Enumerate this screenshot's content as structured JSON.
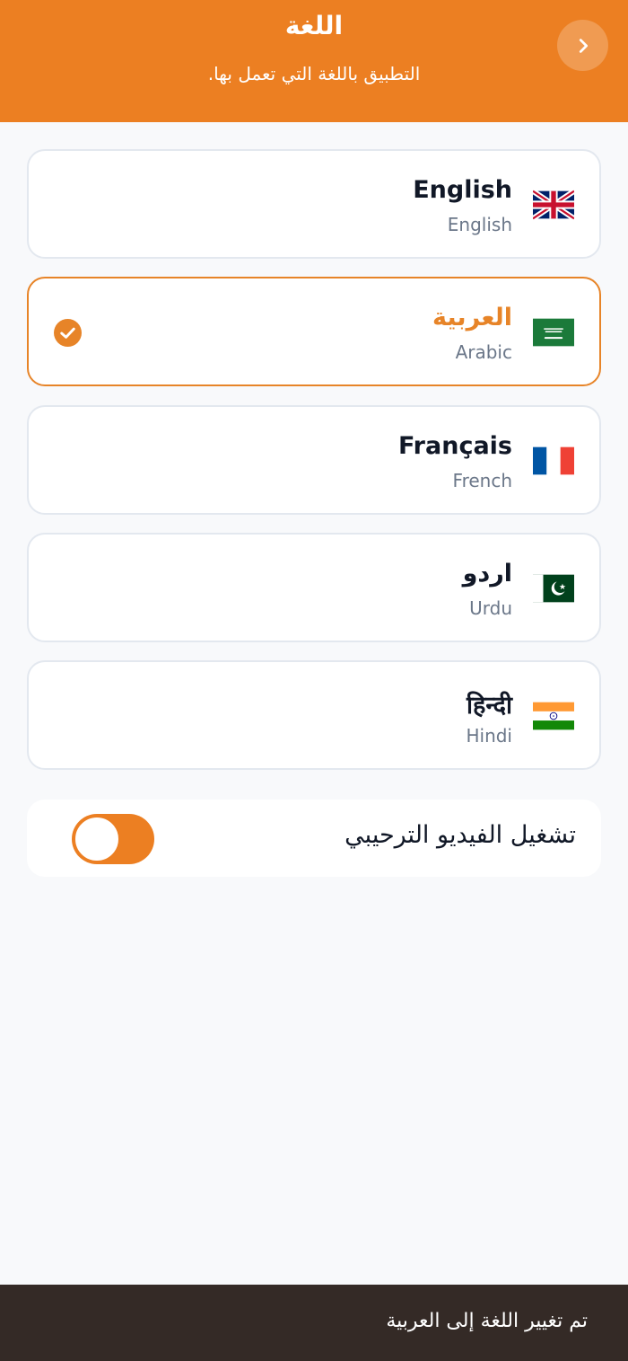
{
  "header": {
    "title": "اللغة",
    "subtitle": "التطبيق باللغة التي تعمل بها.",
    "back_icon": "chevron-right-icon"
  },
  "languages": [
    {
      "name": "English",
      "sub": "English",
      "flag": "uk-flag-icon",
      "selected": false
    },
    {
      "name": "العربية",
      "sub": "Arabic",
      "flag": "saudi-flag-icon",
      "selected": true
    },
    {
      "name": "Français",
      "sub": "French",
      "flag": "france-flag-icon",
      "selected": false
    },
    {
      "name": "اردو",
      "sub": "Urdu",
      "flag": "pakistan-flag-icon",
      "selected": false
    },
    {
      "name": "हिन्दी",
      "sub": "Hindi",
      "flag": "india-flag-icon",
      "selected": false
    }
  ],
  "intro_video": {
    "label": "تشغيل الفيديو الترحيبي",
    "enabled": true
  },
  "toast": {
    "message": "تم تغيير اللغة إلى العربية"
  },
  "colors": {
    "accent": "#ec7f22",
    "toast_bg": "#342a26",
    "page_bg": "#f8f9fb"
  }
}
